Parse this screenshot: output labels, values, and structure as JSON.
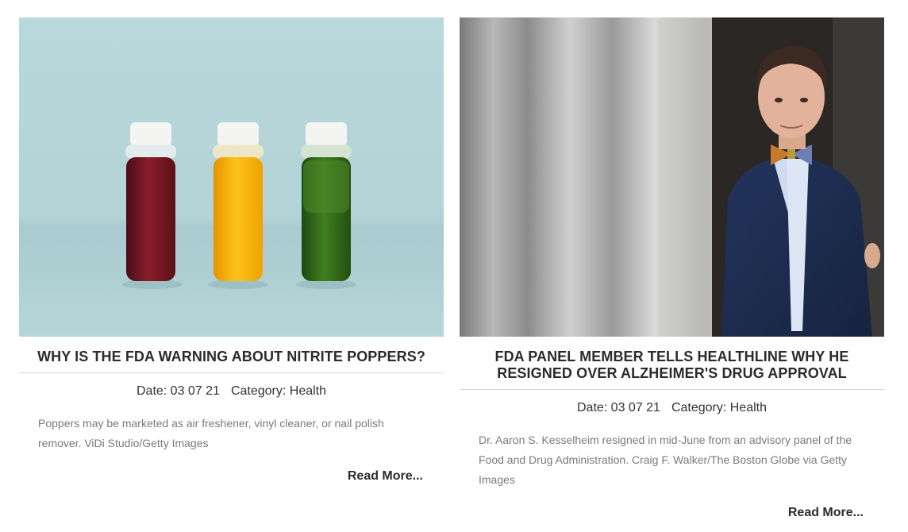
{
  "posts": [
    {
      "image_alt": "Three bottles of juice: red, orange and green on light blue background",
      "title": "WHY IS THE FDA WARNING ABOUT NITRITE POPPERS?",
      "date_label": "Date: 03 07 21",
      "category_label": "Category: Health",
      "excerpt": "Poppers may be marketed as air freshener, vinyl cleaner, or nail polish remover. ViDi Studio/Getty Images",
      "read_more": "Read More..."
    },
    {
      "image_alt": "Man in blue suit and bow tie standing by a curtain",
      "title": "FDA PANEL MEMBER TELLS HEALTHLINE WHY HE RESIGNED OVER ALZHEIMER'S DRUG APPROVAL",
      "date_label": "Date: 03 07 21",
      "category_label": "Category: Health",
      "excerpt": "Dr. Aaron S. Kesselheim resigned in mid-June from an advisory panel of the Food and Drug Administration. Craig F. Walker/The Boston Globe via Getty Images",
      "read_more": "Read More..."
    }
  ]
}
